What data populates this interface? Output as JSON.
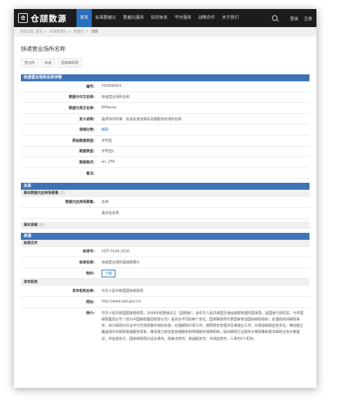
{
  "nav": {
    "logo_glyph": "仓",
    "logo_text": "仓颉数源",
    "items": [
      "首页",
      "标准数据元",
      "数据元服务",
      "知识体系",
      "平台服务",
      "战略合作",
      "关于我们"
    ],
    "login": "登录",
    "register": "注册"
  },
  "breadcrumb": {
    "prefix": "当前位置:",
    "items": [
      "首页",
      "标准数据元",
      "数据元",
      "详情"
    ]
  },
  "page": {
    "title": "快递营业场所名称",
    "tags": [
      "营业所",
      "快递",
      "国家邮政局"
    ]
  },
  "detail": {
    "header": "快递营业场所名称详情",
    "rows": [
      {
        "label": "编号:",
        "value": "YZ0000001"
      },
      {
        "label": "数据元中文名称:",
        "value": "快递营业场所名称"
      },
      {
        "label": "数据元英文名称:",
        "value": "EPName"
      },
      {
        "label": "定义说明:",
        "value": "提供快件收寄、投递及其他相关关键服务的场所名称"
      },
      {
        "label": "领域分类:",
        "value": "邮政"
      },
      {
        "label": "原始数据类型:",
        "value": "字符型"
      },
      {
        "label": "数据类型:",
        "value": "字符型C"
      },
      {
        "label": "数据格式:",
        "value": "an..256"
      },
      {
        "label": "备注:",
        "value": ""
      }
    ]
  },
  "relations": {
    "header": "关系",
    "scene_title": "相关数据元应用场景集",
    "scene_count": "(1)",
    "scene_label": "数据元应用场景集:",
    "scene_values": [
      "名称",
      "基本信息类"
    ],
    "field_title": "相关领域",
    "field_count": "(0)"
  },
  "source": {
    "header": "来源",
    "std_title": "标准文件",
    "std_rows": [
      {
        "label": "标准号:",
        "value": "YZ/T 0156-2016"
      },
      {
        "label": "标准名称:",
        "value": "快递营业场所基础数据元"
      }
    ],
    "attachment_label": "附件:",
    "download": "下载",
    "org_title": "发布机构",
    "org_rows": [
      {
        "label": "发布机构名称:",
        "value": "中华人民共和国国家邮政局"
      },
      {
        "label": "网址:",
        "value": "http://www.spb.gov.cn/"
      }
    ],
    "intro_label": "简介:",
    "intro": "中华人民共和国国家邮政局，2008年经重组设立（副部级），由中华人民共和国交通运输部管理的国家局，是国家行政机关。与中国邮政集团公司（现为中国邮政集团有限公司）是完全不同的两个单位。国家邮政局代表国家参加国际邮政组织，处理政府间邮政事务，拟订邮政对外合作与交流政策并组织实施，处理邮政外事工作，按照规定管理涉及港澳台工作。并承担邮政监管责任，推动建立覆盖城乡的邮政普遍服务体系，推进建立和完善普遍服务和特殊服务保障机制，提出邮政行业服务价格政策和基本邮政业务价格建议，并监督执行。国家邮政局内设办事司、政策法规司、普遍服务司、市场监管司、人事司5个机构。"
  }
}
